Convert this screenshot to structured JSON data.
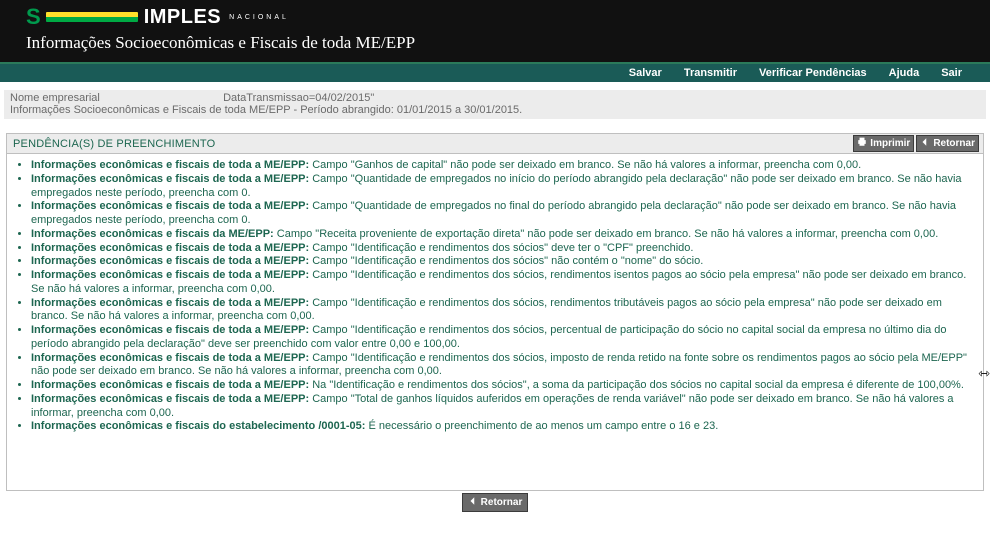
{
  "logo": {
    "s": "S",
    "word": "IMPLES",
    "tag": "NACIONAL"
  },
  "title": "Informações Socioeconômicas e Fiscais de toda ME/EPP",
  "nav": {
    "salvar": "Salvar",
    "transmitir": "Transmitir",
    "verificar": "Verificar Pendências",
    "ajuda": "Ajuda",
    "sair": "Sair"
  },
  "info": {
    "nome_label": "Nome empresarial",
    "data_label": "DataTransmissao=04/02/2015\"",
    "period": "Informações Socioeconômicas e Fiscais de toda ME/EPP - Período abrangido: 01/01/2015 a 30/01/2015."
  },
  "panel": {
    "heading": "PENDÊNCIA(S) DE PREENCHIMENTO",
    "print": "Imprimir",
    "back": "Retornar",
    "bottom_back": "Retornar"
  },
  "items": [
    {
      "b": "Informações econômicas e fiscais de toda a ME/EPP:",
      "t": " Campo \"Ganhos de capital\" não pode ser deixado em branco. Se não há valores a informar, preencha com 0,00."
    },
    {
      "b": "Informações econômicas e fiscais de toda a ME/EPP:",
      "t": " Campo \"Quantidade de empregados no início do período abrangido pela declaração\" não pode ser deixado em branco. Se não havia empregados neste período, preencha com 0."
    },
    {
      "b": "Informações econômicas e fiscais de toda a ME/EPP:",
      "t": " Campo \"Quantidade de empregados no final do período abrangido pela declaração\" não pode ser deixado em branco. Se não havia empregados neste período, preencha com 0."
    },
    {
      "b": "Informações econômicas e fiscais da ME/EPP:",
      "t": " Campo \"Receita proveniente de exportação direta\" não pode ser deixado em branco. Se não há valores a informar, preencha com 0,00."
    },
    {
      "b": "Informações econômicas e fiscais de toda a ME/EPP:",
      "t": " Campo \"Identificação e rendimentos dos sócios\" deve ter o \"CPF\" preenchido."
    },
    {
      "b": "Informações econômicas e fiscais de toda a ME/EPP:",
      "t": " Campo \"Identificação e rendimentos dos sócios\" não contém o \"nome\" do sócio."
    },
    {
      "b": "Informações econômicas e fiscais de toda a ME/EPP:",
      "t": " Campo \"Identificação e rendimentos dos sócios, rendimentos isentos pagos ao sócio pela empresa\" não pode ser deixado em branco. Se não há valores a informar, preencha com 0,00."
    },
    {
      "b": "Informações econômicas e fiscais de toda a ME/EPP:",
      "t": " Campo \"Identificação e rendimentos dos sócios, rendimentos tributáveis pagos ao sócio pela empresa\" não pode ser deixado em branco. Se não há valores a informar, preencha com 0,00."
    },
    {
      "b": "Informações econômicas e fiscais de toda a ME/EPP:",
      "t": " Campo \"Identificação e rendimentos dos sócios, percentual de participação do sócio no capital social da empresa no último dia do período abrangido pela declaração\" deve ser preenchido com valor entre 0,00 e 100,00."
    },
    {
      "b": "Informações econômicas e fiscais de toda a ME/EPP:",
      "t": " Campo \"Identificação e rendimentos dos sócios, imposto de renda retido na fonte sobre os rendimentos pagos ao sócio pela ME/EPP\" não pode ser deixado em branco. Se não há valores a informar, preencha com 0,00."
    },
    {
      "b": "Informações econômicas e fiscais de toda a ME/EPP:",
      "t": " Na \"Identificação e rendimentos dos sócios\", a soma da participação dos sócios no capital social da empresa é diferente de 100,00%."
    },
    {
      "b": "Informações econômicas e fiscais de toda a ME/EPP:",
      "t": " Campo \"Total de ganhos líquidos auferidos em operações de renda variável\" não pode ser deixado em branco. Se não há valores a informar, preencha com 0,00."
    },
    {
      "b": "Informações econômicas e fiscais do estabelecimento                         /0001-05:",
      "t": " É necessário o preenchimento de ao menos um campo entre o 16 e 23."
    }
  ]
}
